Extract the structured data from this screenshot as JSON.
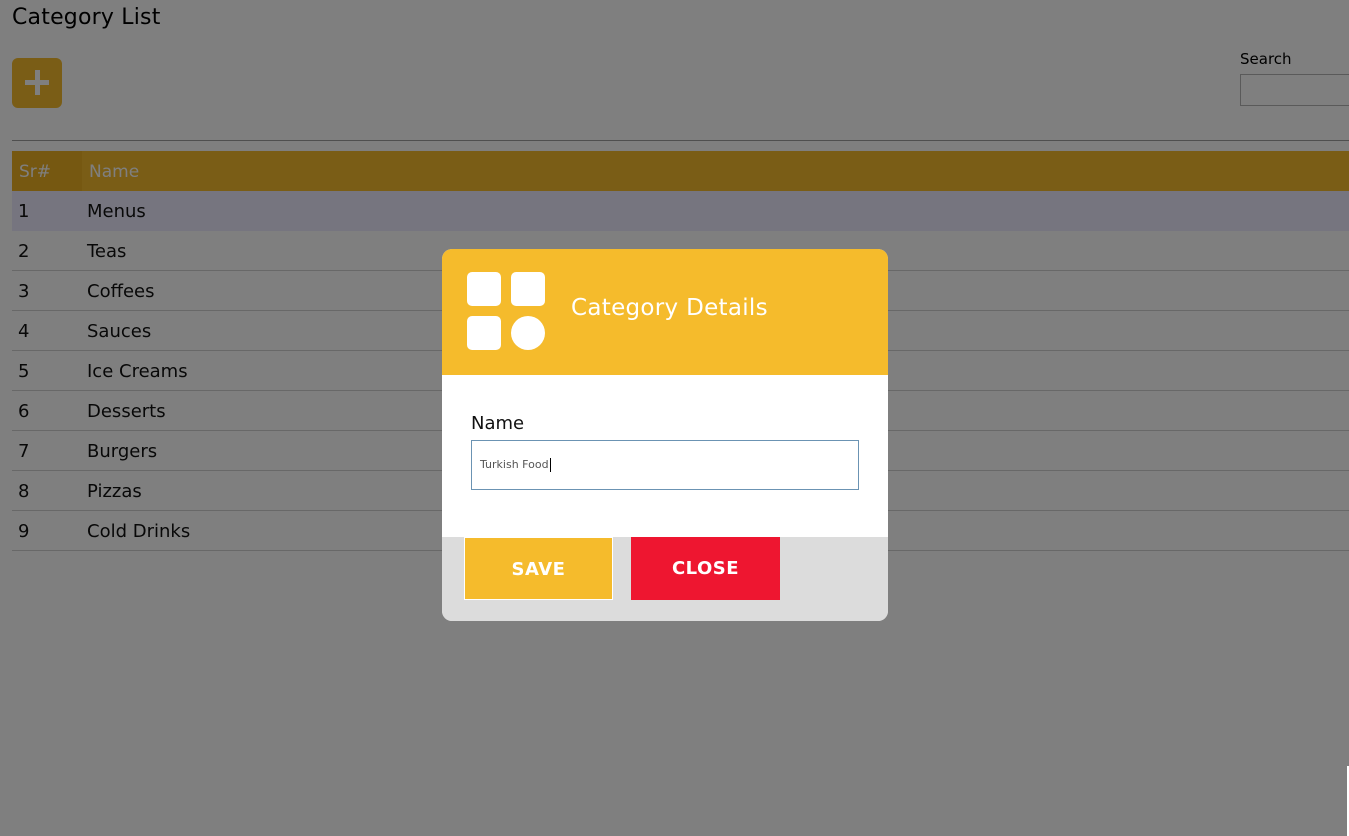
{
  "page": {
    "title": "Category List",
    "add_icon": "plus-icon",
    "search_label": "Search",
    "search_value": ""
  },
  "table": {
    "headers": [
      "Sr#",
      "Name"
    ],
    "rows": [
      {
        "sr": "1",
        "name": "Menus"
      },
      {
        "sr": "2",
        "name": "Teas"
      },
      {
        "sr": "3",
        "name": "Coffees"
      },
      {
        "sr": "4",
        "name": "Sauces"
      },
      {
        "sr": "5",
        "name": "Ice Creams"
      },
      {
        "sr": "6",
        "name": "Desserts"
      },
      {
        "sr": "7",
        "name": "Burgers"
      },
      {
        "sr": "8",
        "name": "Pizzas"
      },
      {
        "sr": "9",
        "name": "Cold Drinks"
      }
    ],
    "selected_row": 1
  },
  "modal": {
    "icon": "category-grid-icon",
    "title": "Category Details",
    "field_label": "Name",
    "field_value": "Turkish Food",
    "save_label": "SAVE",
    "close_label": "CLOSE"
  },
  "colors": {
    "accent": "#f5bb2c",
    "danger": "#ee1630",
    "selected_row": "#ecebff"
  }
}
